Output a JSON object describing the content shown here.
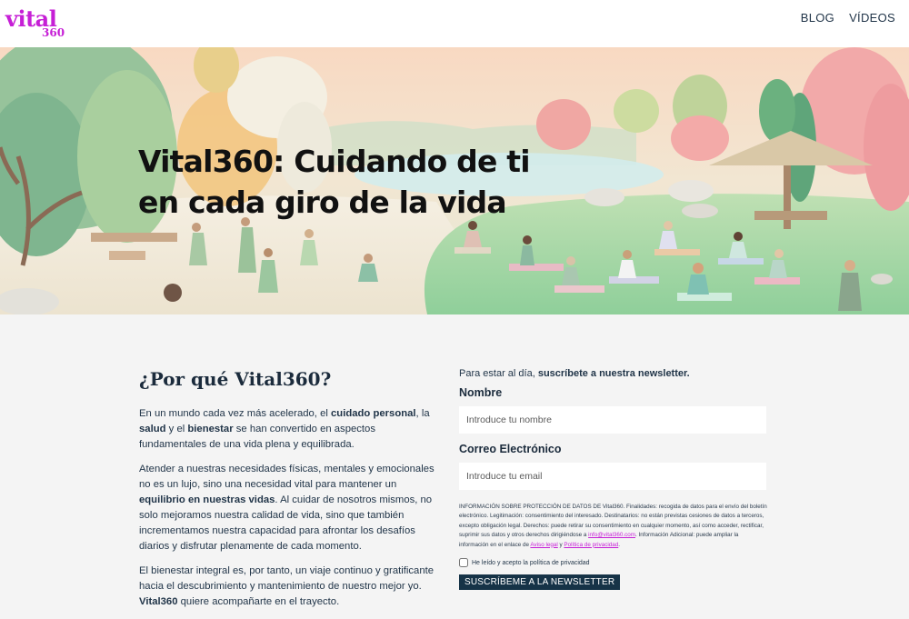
{
  "header": {
    "logo_main": "vital",
    "logo_sub": "360",
    "nav": [
      "BLOG",
      "VÍDEOS"
    ]
  },
  "hero": {
    "title_line1": "Vital360: Cuidando de ti",
    "title_line2": "en cada giro de la vida"
  },
  "why": {
    "title": "¿Por qué Vital360?",
    "p1": [
      "En un mundo cada vez más acelerado, el ",
      "cuidado personal",
      ", la ",
      "salud",
      " y el ",
      "bienestar",
      " se han convertido en aspectos fundamentales de una vida plena y equilibrada."
    ],
    "p2": [
      "Atender a nuestras necesidades físicas, mentales y emocionales no es un lujo, sino una necesidad vital para mantener un ",
      "equilibrio en nuestras vidas",
      ". Al cuidar de nosotros mismos, no solo mejoramos nuestra calidad de vida, sino que también incrementamos nuestra capacidad para afrontar los desafíos diarios y disfrutar plenamente de cada momento."
    ],
    "p3": [
      "El bienestar integral es, por tanto, un viaje continuo y gratificante hacia el descubrimiento y mantenimiento de nuestro mejor yo. ",
      "Vital360",
      " quiere acompañarte en el trayecto."
    ]
  },
  "newsletter": {
    "intro_prefix": "Para estar al día, ",
    "intro_bold": "suscríbete a nuestra newsletter.",
    "name_label": "Nombre",
    "name_placeholder": "Introduce tu nombre",
    "email_label": "Correo Electrónico",
    "email_placeholder": "Introduce tu email",
    "legal_text": "INFORMACIÓN SOBRE PROTECCIÓN DE DATOS DE Vital360. Finalidades: recogida de datos para el envío del boletín electrónico. Legitimación: consentimiento del interesado. Destinatarios: no están previstas cesiones de datos a terceros, excepto obligación legal. Derechos: puede retirar su consentimiento en cualquier momento, así como acceder, rectificar, suprimir sus datos y otros derechos dirigiéndose a ",
    "legal_email": "info@vital360.com",
    "legal_mid": ". Información Adicional: puede ampliar la información en el enlace de ",
    "legal_link1": "Aviso legal",
    "legal_and": " y ",
    "legal_link2": "Política de privacidad",
    "legal_end": ".",
    "consent_label": "He leído y acepto la política de privacidad",
    "button_label": "SUSCRÍBEME A LA NEWSLETTER"
  },
  "colors": {
    "brand": "#c61fd6",
    "text": "#1f3347",
    "button_bg": "#163347"
  }
}
